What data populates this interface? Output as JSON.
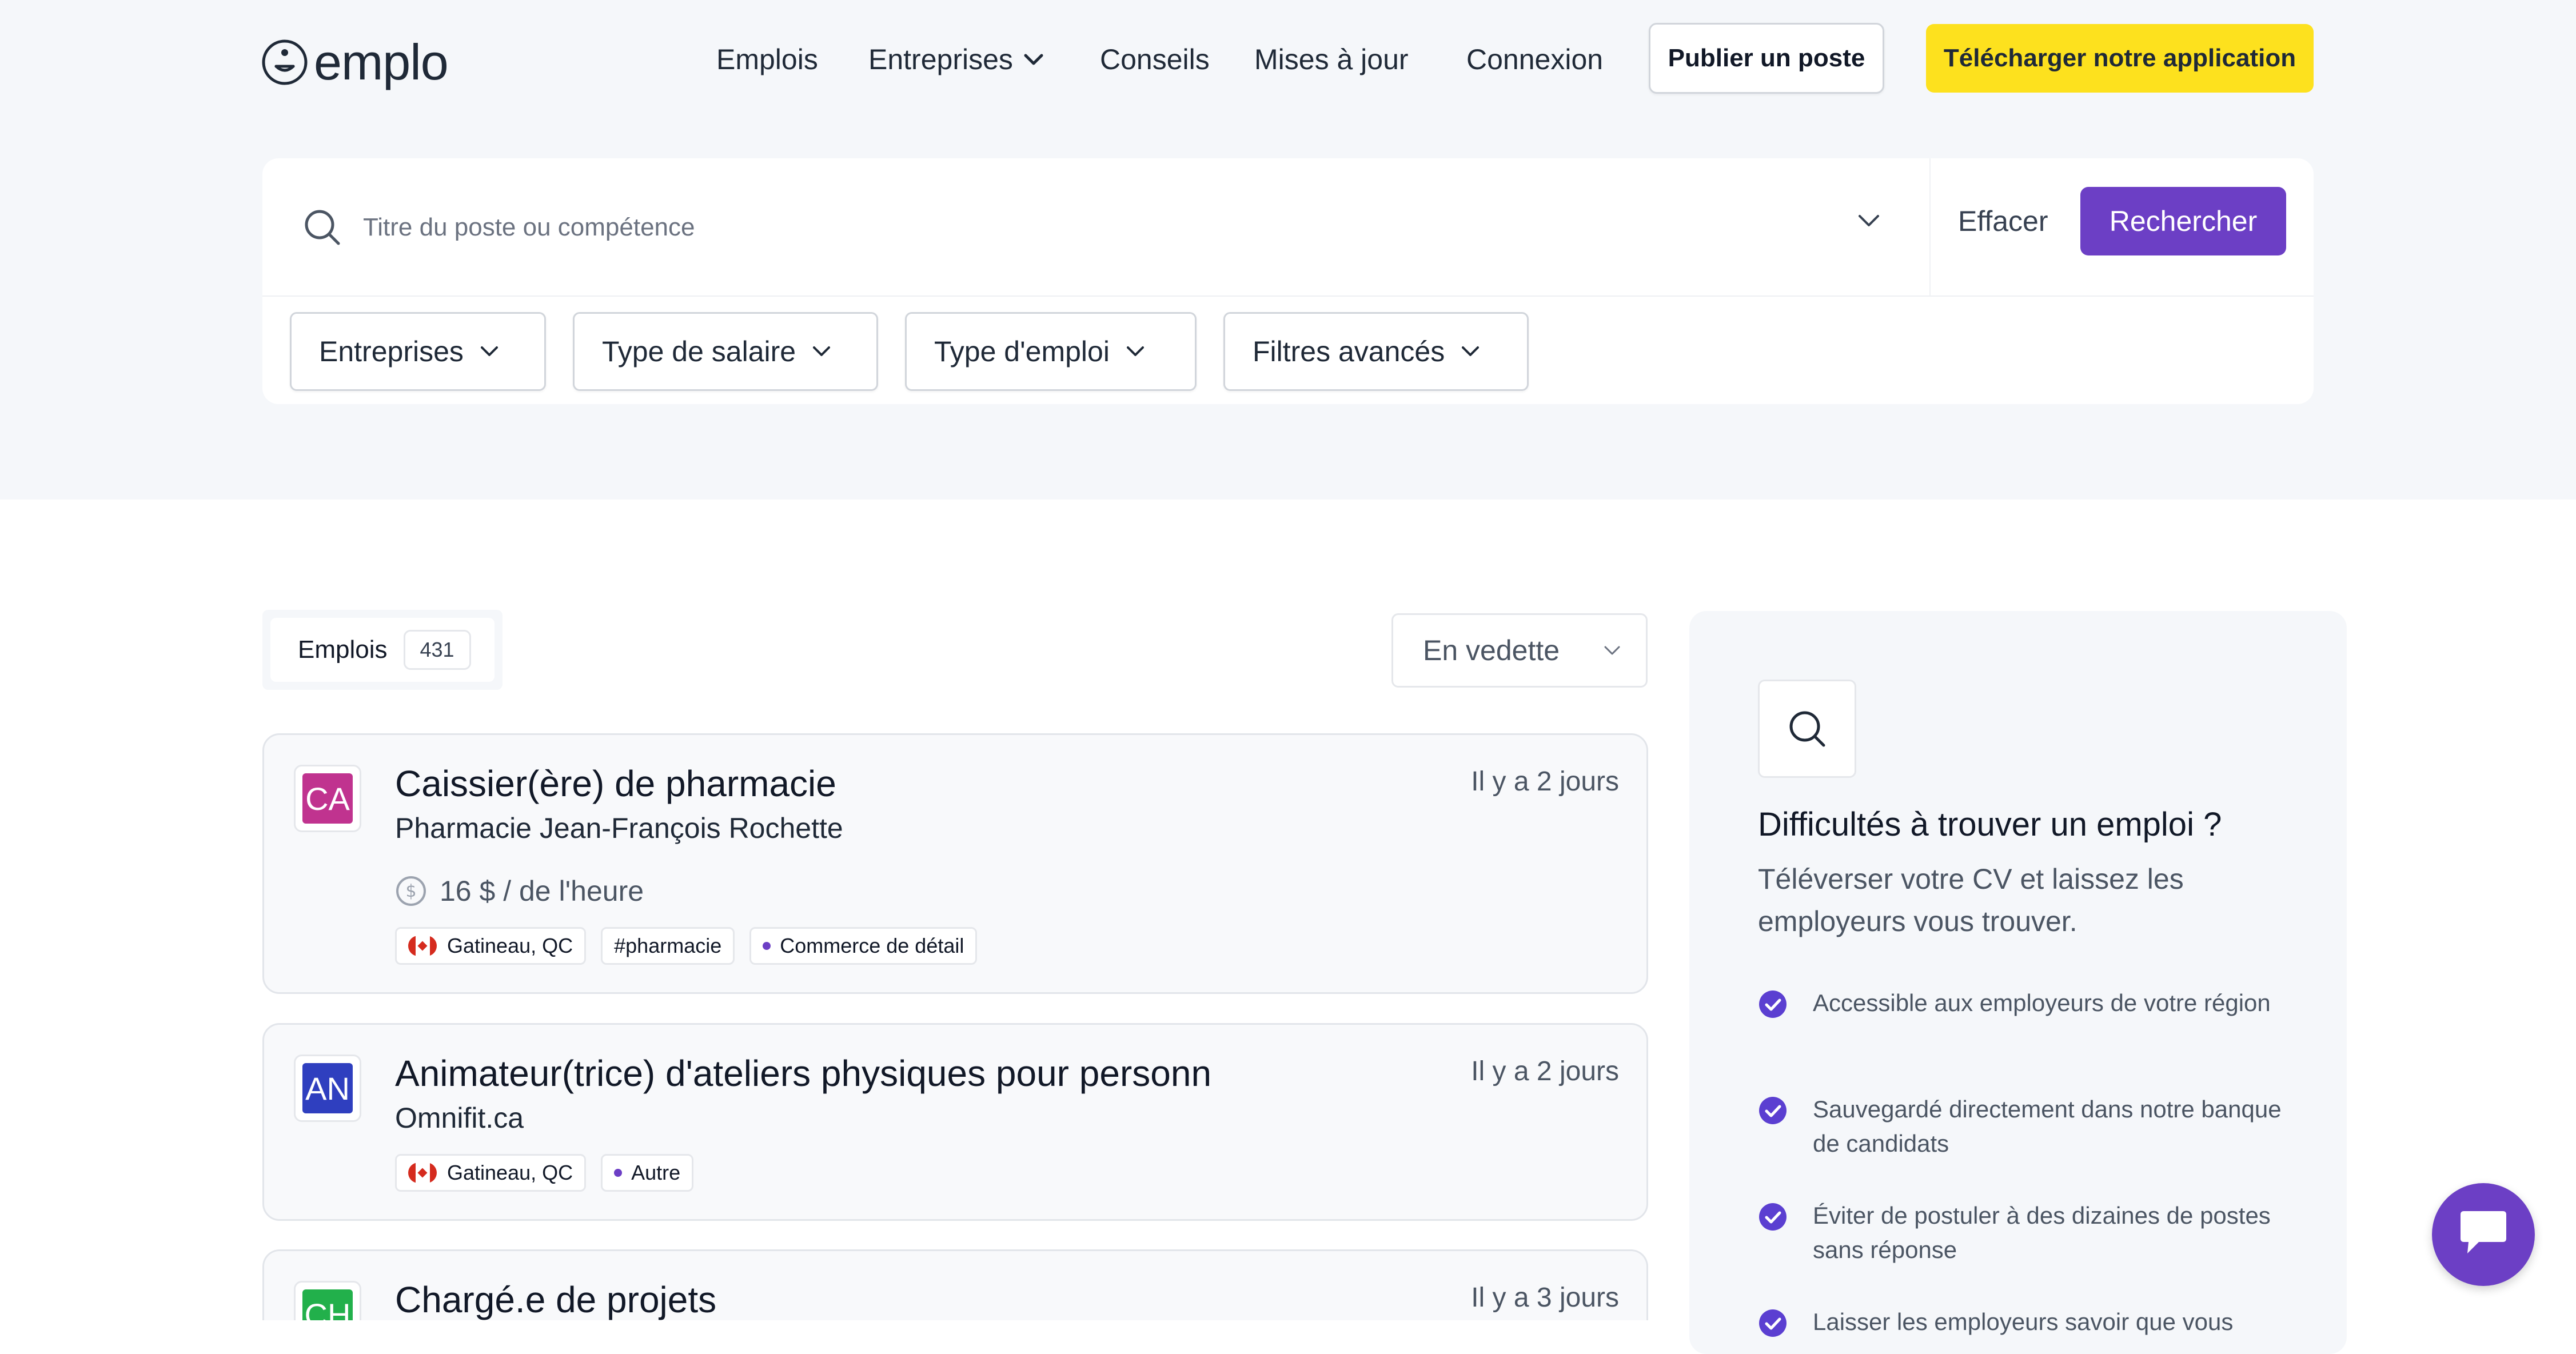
{
  "header": {
    "logo_text": "emplo",
    "nav": [
      "Emplois",
      "Entreprises",
      "Conseils",
      "Mises à jour",
      "Connexion"
    ],
    "post_job": "Publier un poste",
    "download_app": "Télécharger notre application"
  },
  "search": {
    "placeholder": "Titre du poste ou compétence",
    "clear": "Effacer",
    "submit": "Rechercher",
    "filters": [
      "Entreprises",
      "Type de salaire",
      "Type d'emploi",
      "Filtres avancés"
    ]
  },
  "jobs_header": {
    "tab_label": "Emplois",
    "count": "431",
    "sort": "En vedette"
  },
  "jobs": [
    {
      "initials": "CA",
      "color": "#c0338f",
      "title": "Caissier(ère) de pharmacie",
      "company": "Pharmacie Jean-François Rochette",
      "time": "Il y a 2 jours",
      "salary": "16 $ / de l'heure",
      "location": "Gatineau, QC",
      "tags": [
        "#pharmacie"
      ],
      "category": "Commerce de détail"
    },
    {
      "initials": "AN",
      "color": "#2f3fbf",
      "title": "Animateur(trice) d'ateliers physiques pour personn",
      "company": "Omnifit.ca",
      "time": "Il y a 2 jours",
      "location": "Gatineau, QC",
      "category": "Autre"
    },
    {
      "initials": "CH",
      "color": "#22b04b",
      "title": "Chargé.e de projets",
      "time": "Il y a 3 jours"
    }
  ],
  "sidebar": {
    "title": "Difficultés à trouver un emploi ?",
    "subtitle": "Téléverser votre CV et laissez les employeurs vous trouver.",
    "benefits": [
      "Accessible aux employeurs de votre région",
      "Sauvegardé directement dans notre banque de candidats",
      "Éviter de postuler à des dizaines de postes sans réponse",
      "Laisser les employeurs savoir que vous"
    ]
  },
  "colors": {
    "accent": "#6c3fc5",
    "yellow": "#fde11e",
    "band": "#f5f7fa"
  }
}
